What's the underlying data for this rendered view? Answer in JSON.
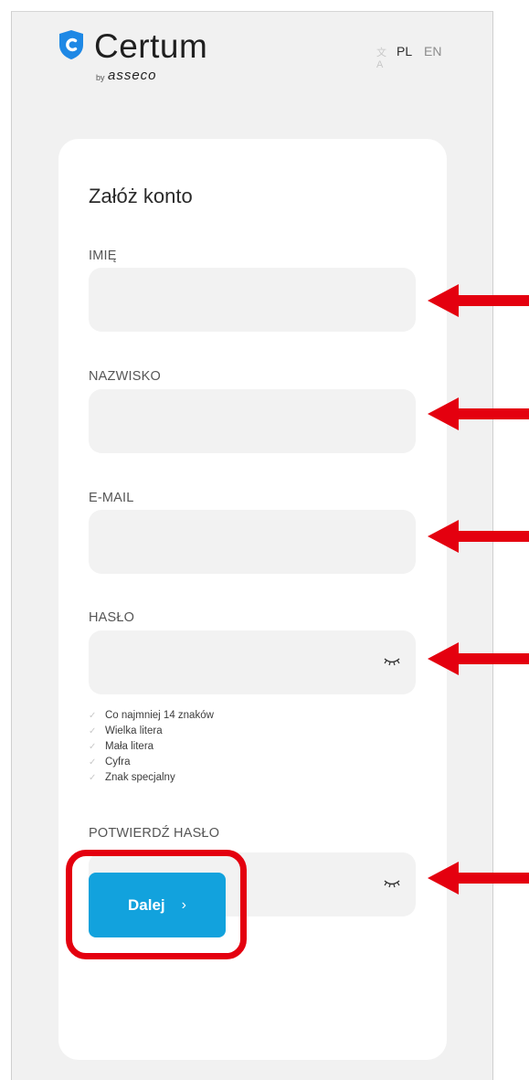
{
  "brand": {
    "name": "Certum",
    "by": "by",
    "parent": "asseco",
    "accent": "#12a2dd",
    "logo_blue": "#1e88e5"
  },
  "language": {
    "icon": "translate-icon",
    "options": [
      "PL",
      "EN"
    ],
    "selected": "PL"
  },
  "form": {
    "title": "Załóż konto",
    "fields": [
      {
        "label": "IMIĘ",
        "value": ""
      },
      {
        "label": "NAZWISKO",
        "value": ""
      },
      {
        "label": "E-MAIL",
        "value": ""
      },
      {
        "label": "HASŁO",
        "value": "",
        "icon": "eye-closed-icon"
      },
      {
        "label": "POTWIERDŹ HASŁO",
        "value": "",
        "icon": "eye-closed-icon"
      }
    ],
    "password_rules": [
      "Co najmniej 14 znaków",
      "Wielka litera",
      "Mała litera",
      "Cyfra",
      "Znak specjalny"
    ],
    "submit_label": "Dalej",
    "submit_icon": "chevron-right-icon"
  },
  "annotations": {
    "arrow_color": "#e4000f",
    "highlight_color": "#e4000f"
  }
}
